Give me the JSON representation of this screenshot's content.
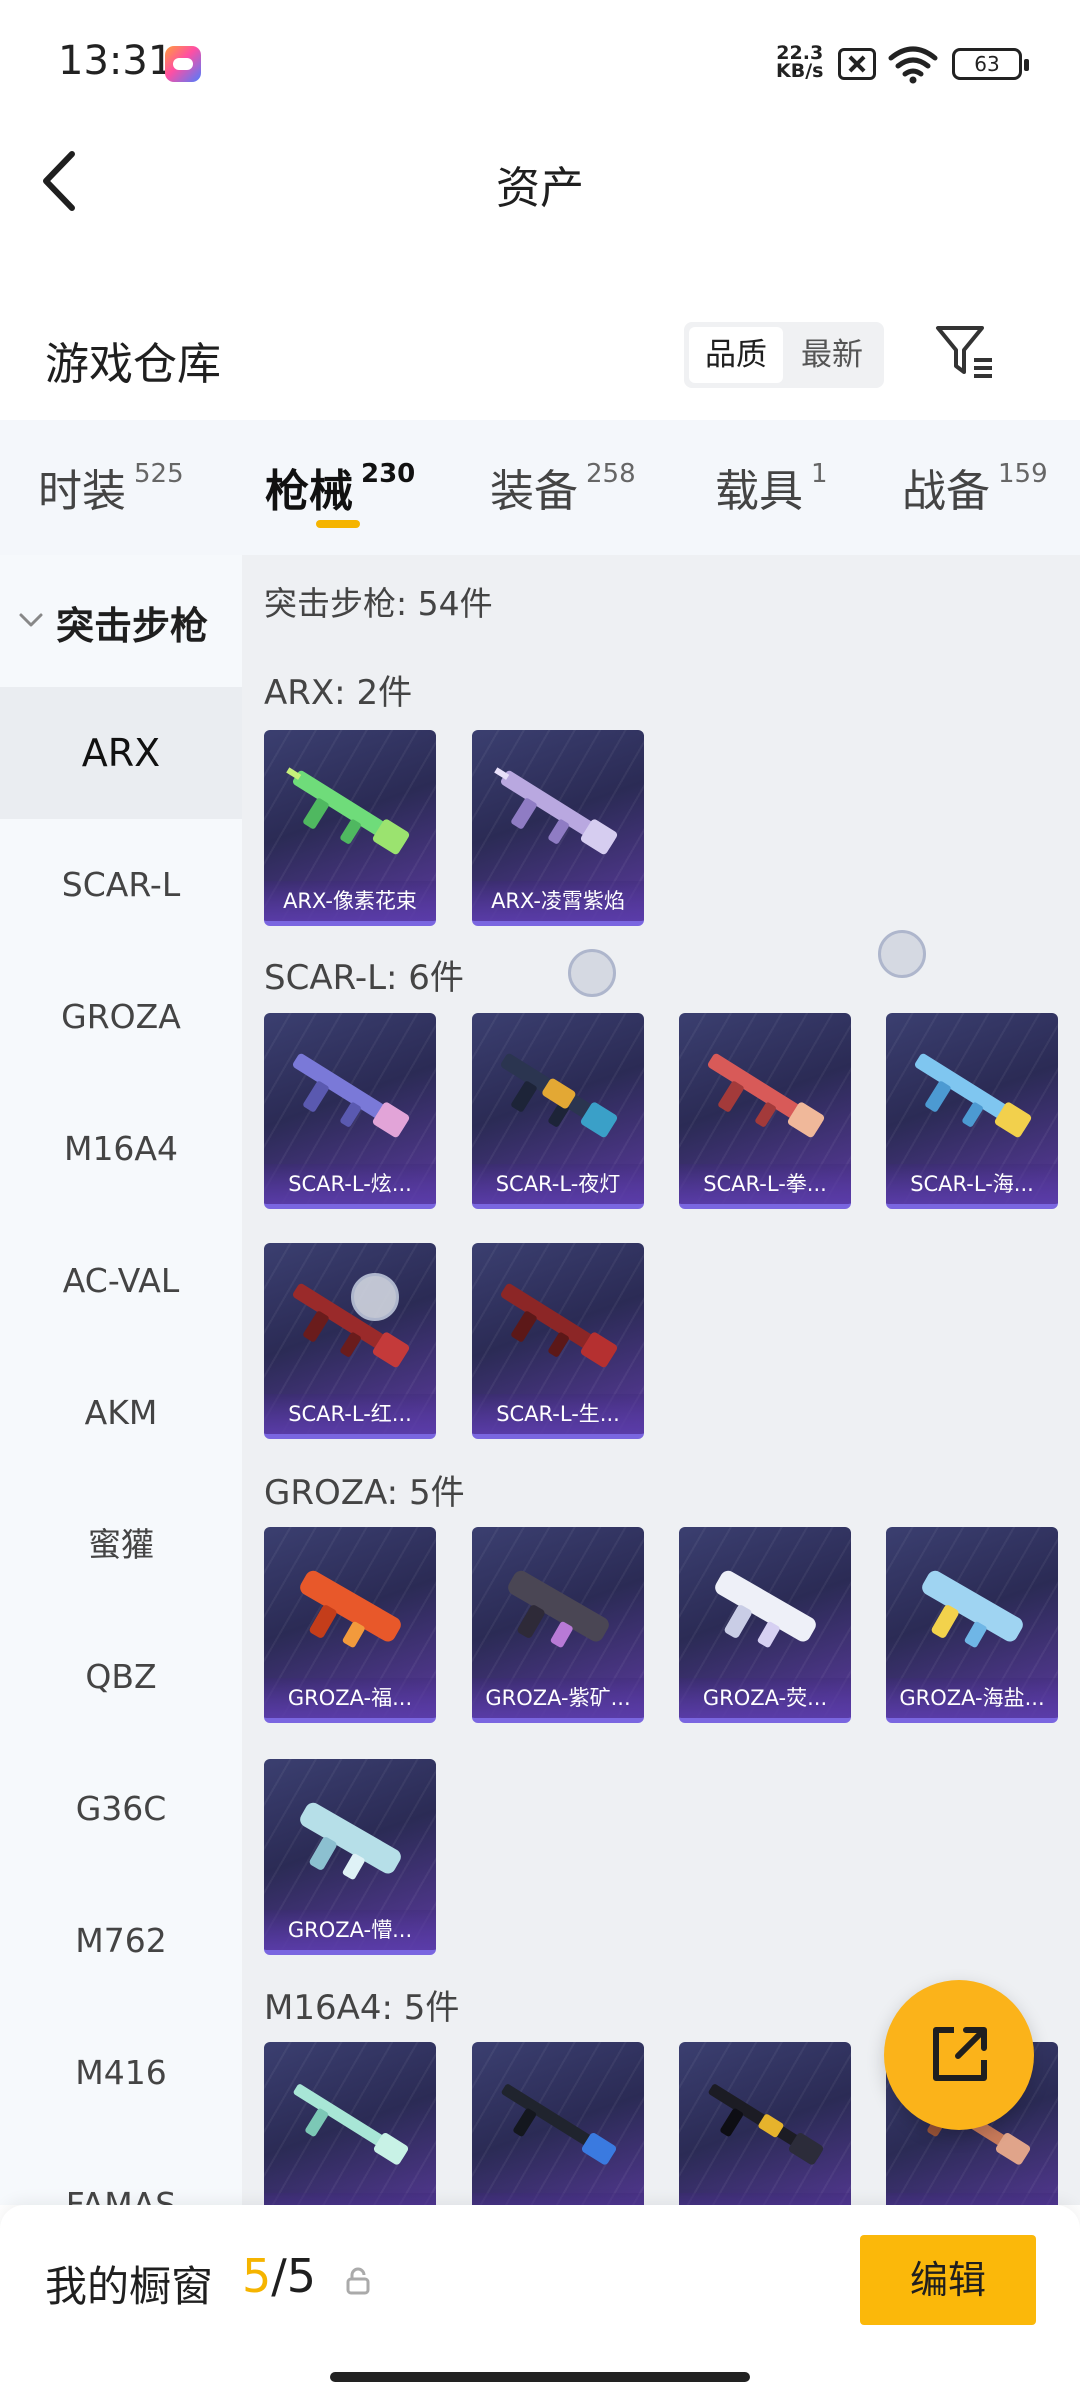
{
  "status_bar": {
    "time": "13:31",
    "net_speed_value": "22.3",
    "net_speed_unit": "KB/s",
    "battery": "63"
  },
  "header": {
    "title": "资产"
  },
  "warehouse": {
    "title": "游戏仓库",
    "sort_options": [
      "品质",
      "最新"
    ],
    "active_sort": "品质"
  },
  "tabs": [
    {
      "label": "时装",
      "count": "525"
    },
    {
      "label": "枪械",
      "count": "230"
    },
    {
      "label": "装备",
      "count": "258"
    },
    {
      "label": "载具",
      "count": "1"
    },
    {
      "label": "战备",
      "count": "159"
    }
  ],
  "sidebar": {
    "group": "突击步枪",
    "items": [
      "ARX",
      "SCAR-L",
      "GROZA",
      "M16A4",
      "AC-VAL",
      "AKM",
      "蜜獾",
      "QBZ",
      "G36C",
      "M762",
      "M416",
      "FAMAS"
    ],
    "active": "ARX"
  },
  "content": {
    "summary": "突击步枪: 54件",
    "groups": [
      {
        "heading": "ARX: 2件",
        "items": [
          "ARX-像素花束",
          "ARX-凌霄紫焰"
        ]
      },
      {
        "heading": "SCAR-L: 6件",
        "items": [
          "SCAR-L-炫...",
          "SCAR-L-夜灯",
          "SCAR-L-拳...",
          "SCAR-L-海...",
          "SCAR-L-红...",
          "SCAR-L-生..."
        ]
      },
      {
        "heading": "GROZA: 5件",
        "items": [
          "GROZA-福...",
          "GROZA-紫矿...",
          "GROZA-荧...",
          "GROZA-海盐...",
          "GROZA-懵..."
        ]
      },
      {
        "heading": "M16A4: 5件",
        "items": [
          "",
          "",
          "",
          ""
        ]
      }
    ]
  },
  "bottom_bar": {
    "showcase_label": "我的橱窗",
    "count_current": "5",
    "count_separator": "/",
    "count_total": "5",
    "edit_label": "编辑"
  },
  "colors": {
    "accent": "#f5b400",
    "card_bg": "#2b2b55",
    "card_border": "#7a66e0"
  },
  "icons": [
    "back-arrow-icon",
    "filter-icon",
    "chevron-down-icon",
    "lock-icon",
    "share-icon",
    "wifi-icon",
    "sim-off-icon",
    "battery-icon",
    "game-app-icon"
  ]
}
